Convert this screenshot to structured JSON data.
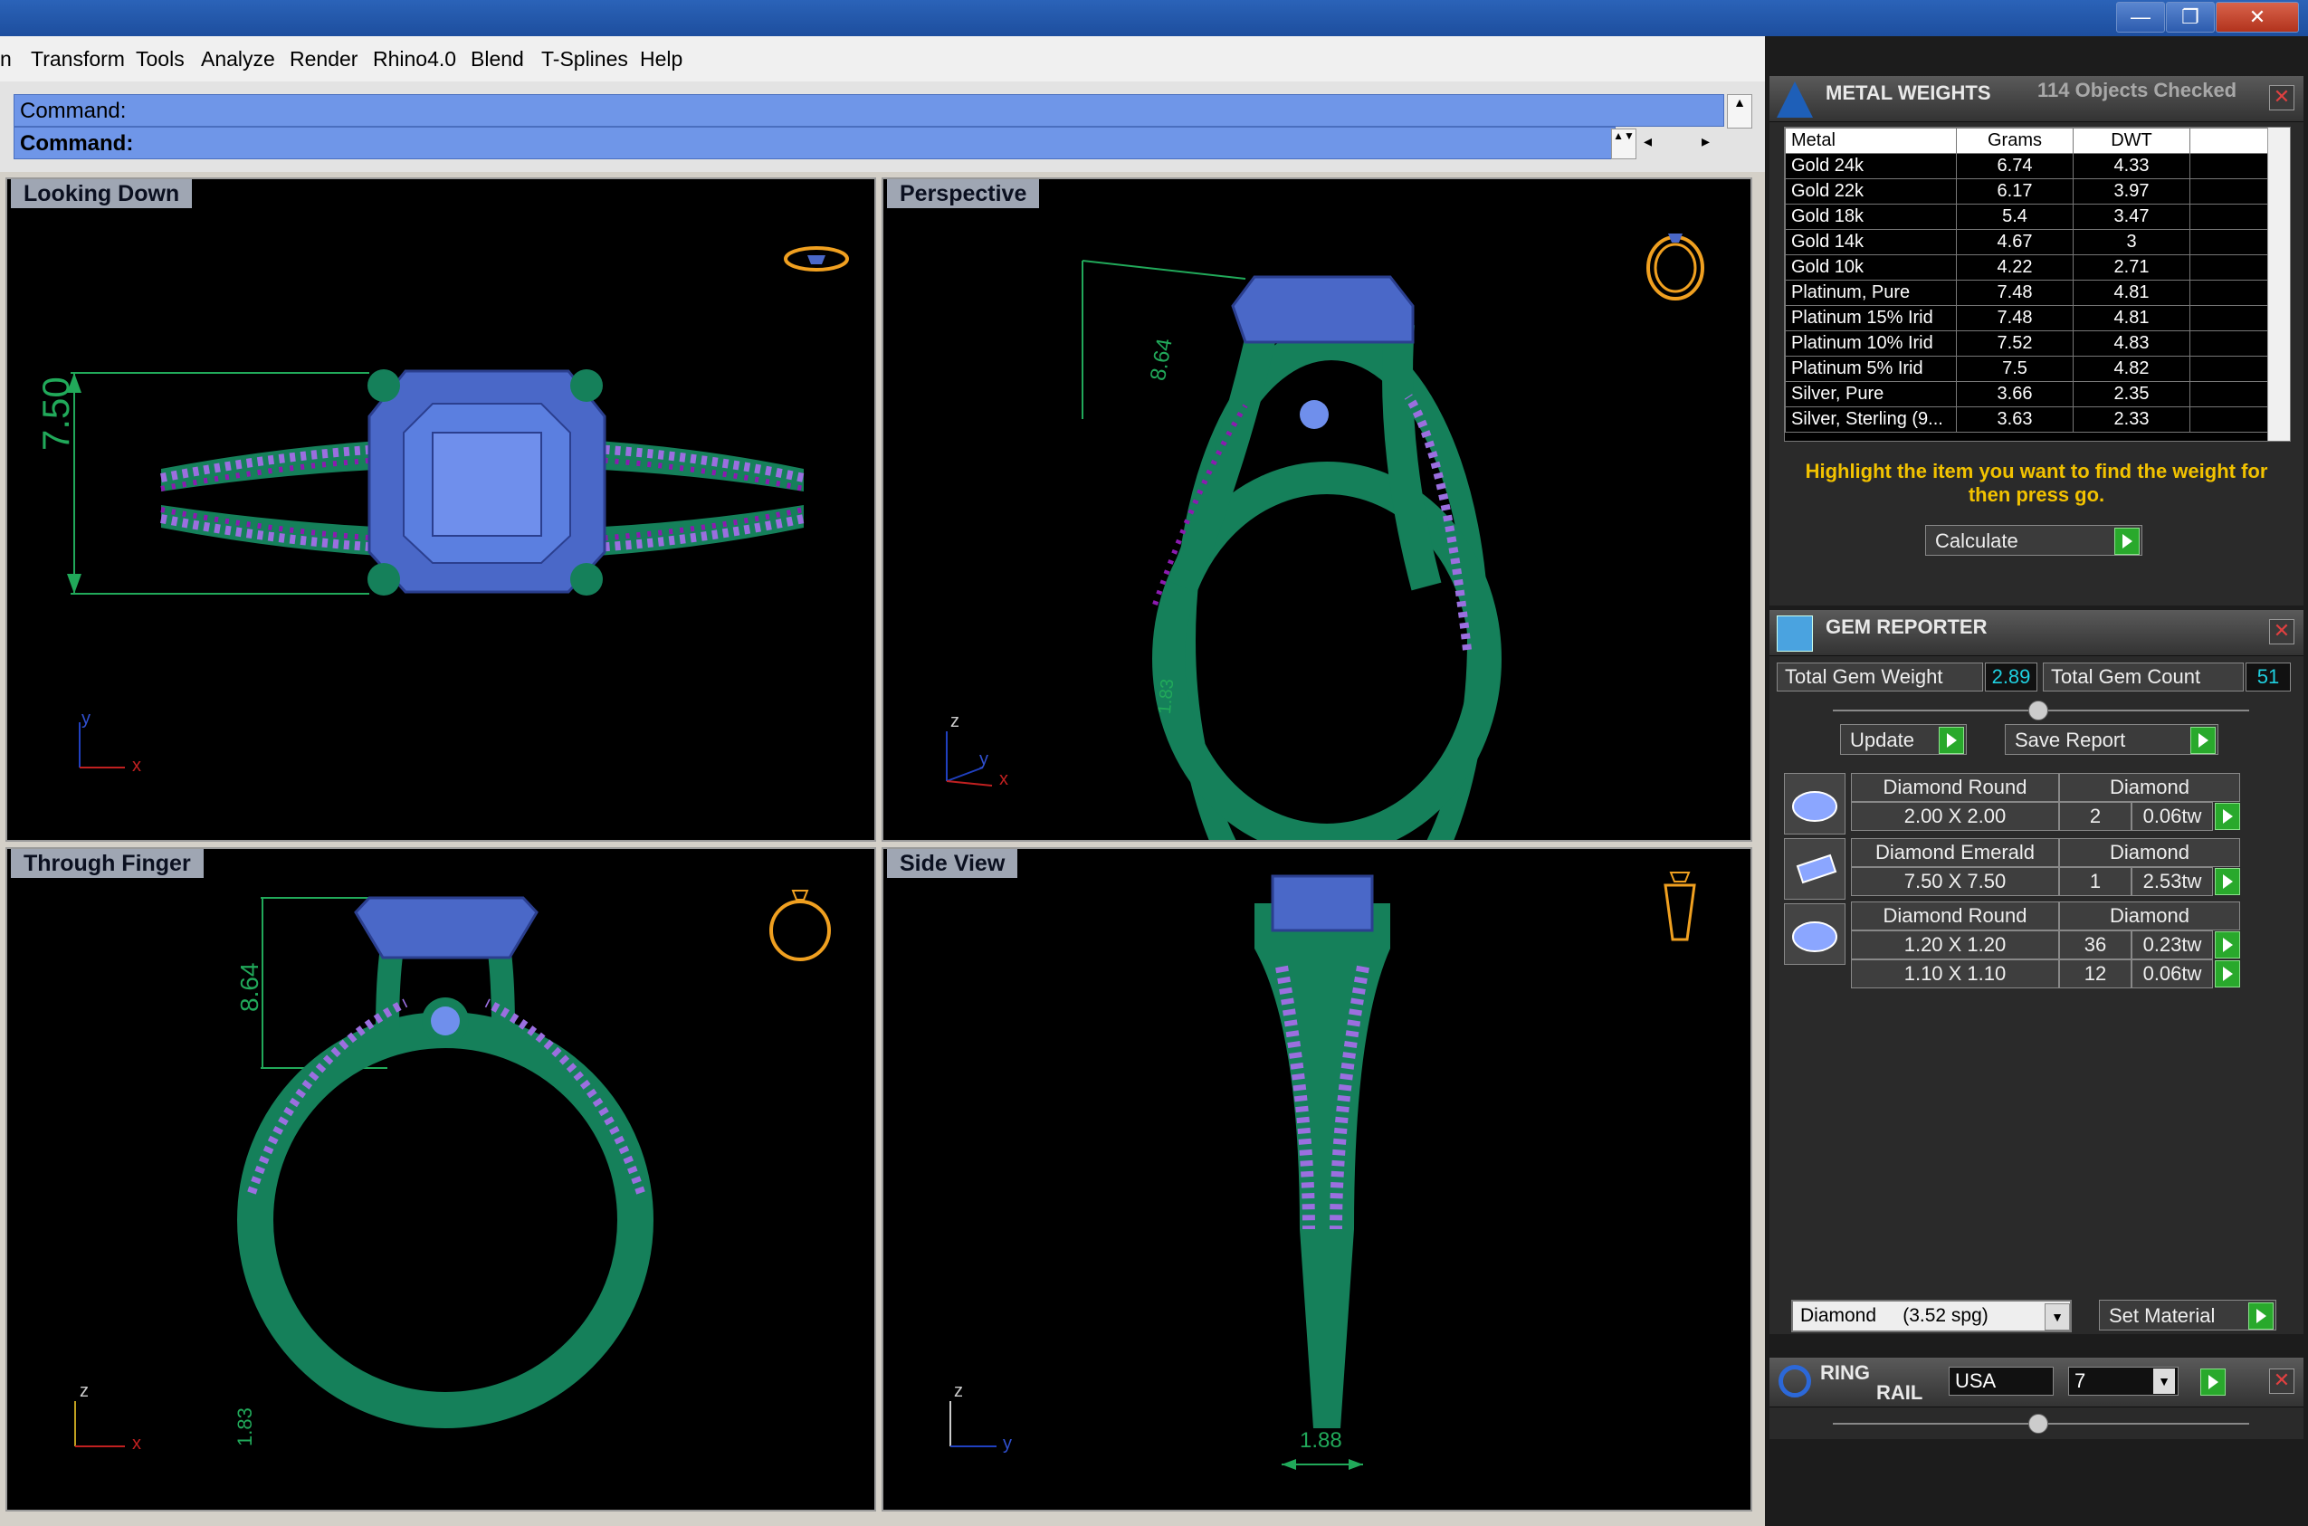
{
  "menubar": {
    "items": [
      "n",
      "Transform",
      "Tools",
      "Analyze",
      "Render",
      "Rhino4.0",
      "Blend",
      "T-Splines",
      "Help"
    ]
  },
  "command": {
    "line1": "Command:",
    "line2": "Command:"
  },
  "viewports": {
    "top_left": {
      "label": "Looking Down",
      "dimension": "7.50",
      "axis1": "y",
      "axis2": "x"
    },
    "top_right": {
      "label": "Perspective",
      "dimension": "8.64",
      "dimension2": "1.83",
      "axis1": "z",
      "axis2": "y",
      "axis3": "x"
    },
    "bottom_left": {
      "label": "Through Finger",
      "dimension": "8.64",
      "dimension2": "1.83",
      "axis1": "z",
      "axis2": "x"
    },
    "bottom_right": {
      "label": "Side View",
      "dimension": "1.88",
      "axis1": "z",
      "axis2": "y"
    }
  },
  "metal_weights": {
    "title": "METAL WEIGHTS",
    "objects": "114 Objects Checked",
    "columns": [
      "Metal",
      "Grams",
      "DWT"
    ],
    "rows": [
      [
        "Gold 24k",
        "6.74",
        "4.33"
      ],
      [
        "Gold 22k",
        "6.17",
        "3.97"
      ],
      [
        "Gold 18k",
        "5.4",
        "3.47"
      ],
      [
        "Gold 14k",
        "4.67",
        "3"
      ],
      [
        "Gold 10k",
        "4.22",
        "2.71"
      ],
      [
        "Platinum, Pure",
        "7.48",
        "4.81"
      ],
      [
        "Platinum 15% Irid",
        "7.48",
        "4.81"
      ],
      [
        "Platinum 10% Irid",
        "7.52",
        "4.83"
      ],
      [
        "Platinum 5% Irid",
        "7.5",
        "4.82"
      ],
      [
        "Silver, Pure",
        "3.66",
        "2.35"
      ],
      [
        "Silver, Sterling (9...",
        "3.63",
        "2.33"
      ]
    ],
    "instructions": "Highlight the item you want to find the weight for then press go.",
    "calculate": "Calculate"
  },
  "gem_reporter": {
    "title": "GEM REPORTER",
    "total_weight_label": "Total Gem Weight",
    "total_weight": "2.89",
    "total_count_label": "Total Gem Count",
    "total_count": "51",
    "update": "Update",
    "save_report": "Save Report",
    "gems": [
      {
        "shape": "Diamond Round",
        "material": "Diamond",
        "size": "2.00 X 2.00",
        "count": "2",
        "weight": "0.06tw"
      },
      {
        "shape": "Diamond Emerald",
        "material": "Diamond",
        "size": "7.50 X 7.50",
        "count": "1",
        "weight": "2.53tw"
      },
      {
        "shape": "Diamond Round",
        "material": "Diamond",
        "size": "1.20 X 1.20",
        "count": "36",
        "weight": "0.23tw"
      },
      {
        "shape": "",
        "material": "",
        "size": "1.10 X 1.10",
        "count": "12",
        "weight": "0.06tw"
      }
    ],
    "material_select": "Diamond     (3.52 spg)",
    "set_material": "Set Material"
  },
  "ring_rail": {
    "title1": "RING",
    "title2": "RAIL",
    "country": "USA",
    "size": "7"
  },
  "colors": {
    "titlebar": "#1d4e9e",
    "metal": "#15805a",
    "gem": "#5b7fe0",
    "pave": "#8b1bb0",
    "dimension": "#21a95a"
  }
}
